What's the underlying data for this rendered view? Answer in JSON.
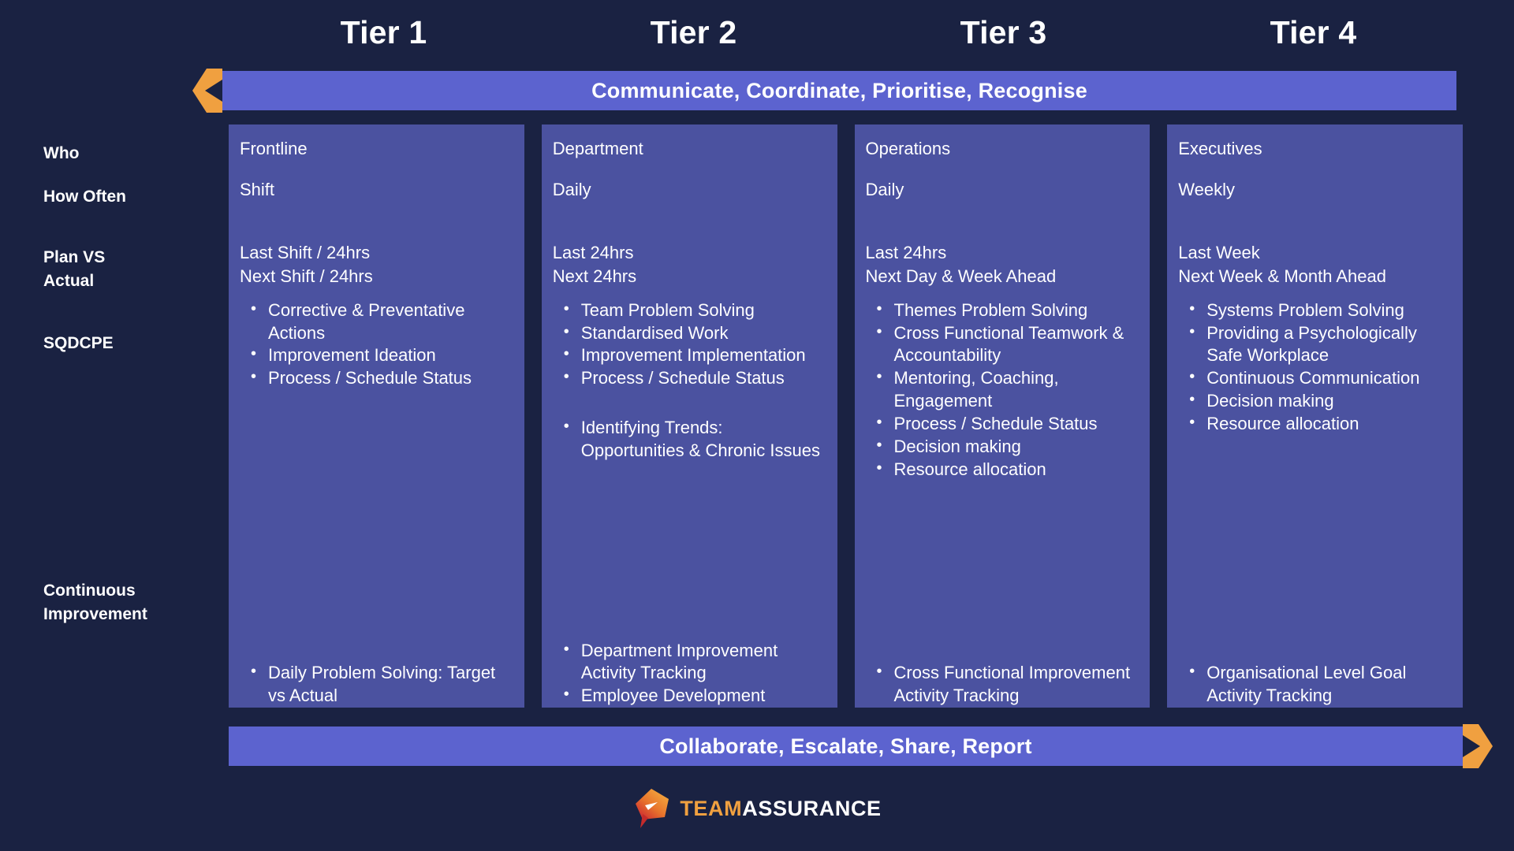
{
  "colors": {
    "background": "#1a2242",
    "panel": "#4b52a0",
    "banner": "#5c63cf",
    "accent_orange": "#f0a040",
    "text": "#ffffff"
  },
  "tier_headings": [
    "Tier 1",
    "Tier 2",
    "Tier 3",
    "Tier 4"
  ],
  "banners": {
    "top": {
      "label": "Communicate, Coordinate, Prioritise, Recognise",
      "chevron": "chevron-left-icon"
    },
    "bottom": {
      "label": "Collaborate, Escalate, Share, Report",
      "chevron": "chevron-right-icon"
    }
  },
  "row_labels": {
    "who": "Who",
    "how_often": "How Often",
    "plan_vs_actual": "Plan VS\nActual",
    "sqdcpe": "SQDCPE",
    "continuous_improvement": "Continuous\nImprovement"
  },
  "columns": [
    {
      "tier": "Tier 1",
      "who": "Frontline",
      "how_often": "Shift",
      "plan_vs_actual": "Last Shift / 24hrs\nNext Shift / 24hrs",
      "sqdcpe": [
        "Corrective & Preventative Actions",
        "Improvement Ideation",
        "Process / Schedule Status"
      ],
      "sqdcpe_second": [],
      "continuous_improvement": [
        "Daily Problem Solving: Target vs Actual"
      ]
    },
    {
      "tier": "Tier 2",
      "who": "Department",
      "how_often": "Daily",
      "plan_vs_actual": "Last 24hrs\nNext 24hrs",
      "sqdcpe": [
        "Team Problem Solving",
        "Standardised Work",
        "Improvement Implementation",
        "Process / Schedule Status"
      ],
      "sqdcpe_second": [
        "Identifying Trends: Opportunities & Chronic Issues"
      ],
      "continuous_improvement": [
        "Department Improvement Activity Tracking",
        "Employee Development"
      ]
    },
    {
      "tier": "Tier 3",
      "who": "Operations",
      "how_often": "Daily",
      "plan_vs_actual": "Last 24hrs\nNext Day & Week Ahead",
      "sqdcpe": [
        "Themes Problem Solving",
        "Cross Functional Teamwork & Accountability",
        "Mentoring, Coaching, Engagement",
        "Process / Schedule Status",
        "Decision making",
        "Resource allocation"
      ],
      "sqdcpe_second": [],
      "continuous_improvement": [
        "Cross Functional Improvement Activity Tracking"
      ]
    },
    {
      "tier": "Tier 4",
      "who": "Executives",
      "how_often": "Weekly",
      "plan_vs_actual": "Last Week\nNext Week & Month Ahead",
      "sqdcpe": [
        "Systems Problem Solving",
        "Providing a Psychologically Safe Workplace",
        "Continuous Communication",
        "Decision making",
        "Resource allocation"
      ],
      "sqdcpe_second": [],
      "continuous_improvement": [
        "Organisational Level Goal Activity Tracking"
      ]
    }
  ],
  "logo": {
    "mark": "teamassurance-pin-icon",
    "word_one": "TEAM",
    "word_two": "ASSURANCE"
  }
}
